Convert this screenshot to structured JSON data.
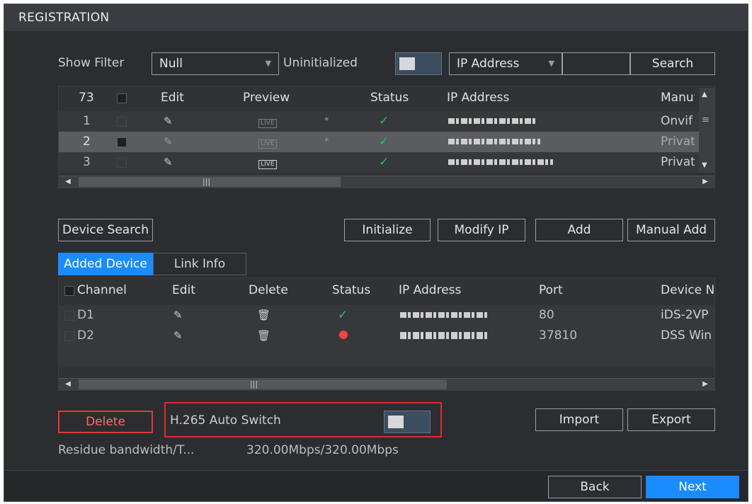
{
  "title": "REGISTRATION",
  "filter": {
    "label": "Show Filter",
    "value": "Null",
    "uninit_label": "Uninitialized",
    "ip_select": "IP Address",
    "search_value": "",
    "search_btn": "Search"
  },
  "search_table": {
    "headers": [
      "73",
      "Edit",
      "Preview",
      "Status",
      "IP Address",
      "Manuf"
    ],
    "rows": [
      {
        "no": "1",
        "star": "*",
        "manuf": "Onvif"
      },
      {
        "no": "2",
        "star": "*",
        "manuf": "Private"
      },
      {
        "no": "3",
        "star": "",
        "manuf": "Private"
      }
    ],
    "live_label": "LIVE"
  },
  "actions": {
    "device_search": "Device Search",
    "initialize": "Initialize",
    "modify_ip": "Modify IP",
    "add": "Add",
    "manual_add": "Manual Add"
  },
  "tabs": {
    "added_device": "Added Device",
    "link_info": "Link Info"
  },
  "added_table": {
    "headers": [
      "Channel",
      "Edit",
      "Delete",
      "Status",
      "IP Address",
      "Port",
      "Device N"
    ],
    "rows": [
      {
        "channel": "D1",
        "status": "online",
        "port": "80",
        "device": "iDS-2VP"
      },
      {
        "channel": "D2",
        "status": "offline",
        "port": "37810",
        "device": "DSS Win"
      }
    ]
  },
  "bottom": {
    "delete": "Delete",
    "h265_label": "H.265 Auto Switch",
    "import": "Import",
    "export": "Export",
    "residue_label": "Residue bandwidth/T...",
    "residue_value": "320.00Mbps/320.00Mbps",
    "back": "Back",
    "next": "Next"
  },
  "colors": {
    "accent": "#1a8cff",
    "online": "#2fbf4a",
    "offline": "#ff4242",
    "highlight_box": "#e02a2a"
  }
}
